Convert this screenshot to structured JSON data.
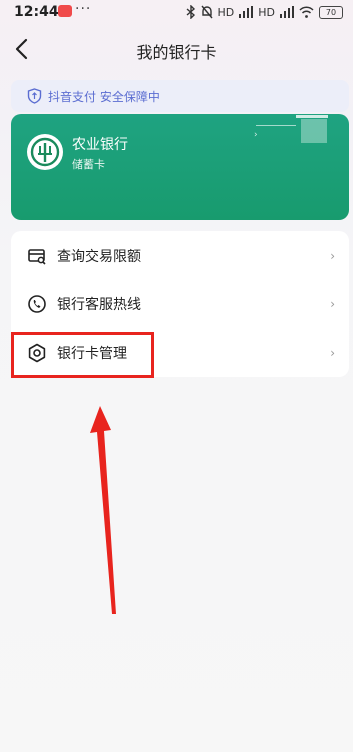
{
  "status_bar": {
    "time": "12:44",
    "dots": "···",
    "battery": "70",
    "network_label": "HD"
  },
  "nav": {
    "title": "我的银行卡"
  },
  "banner": {
    "text": "抖音支付 安全保障中"
  },
  "card": {
    "bank_name": "农业银行",
    "card_type": "储蓄卡",
    "color": "#1fa381"
  },
  "menu": {
    "items": [
      {
        "label": "查询交易限额",
        "icon": "card-search-icon"
      },
      {
        "label": "银行客服热线",
        "icon": "phone-icon"
      },
      {
        "label": "银行卡管理",
        "icon": "gear-icon"
      }
    ]
  },
  "annotation": {
    "highlight_color": "#e8241e"
  }
}
